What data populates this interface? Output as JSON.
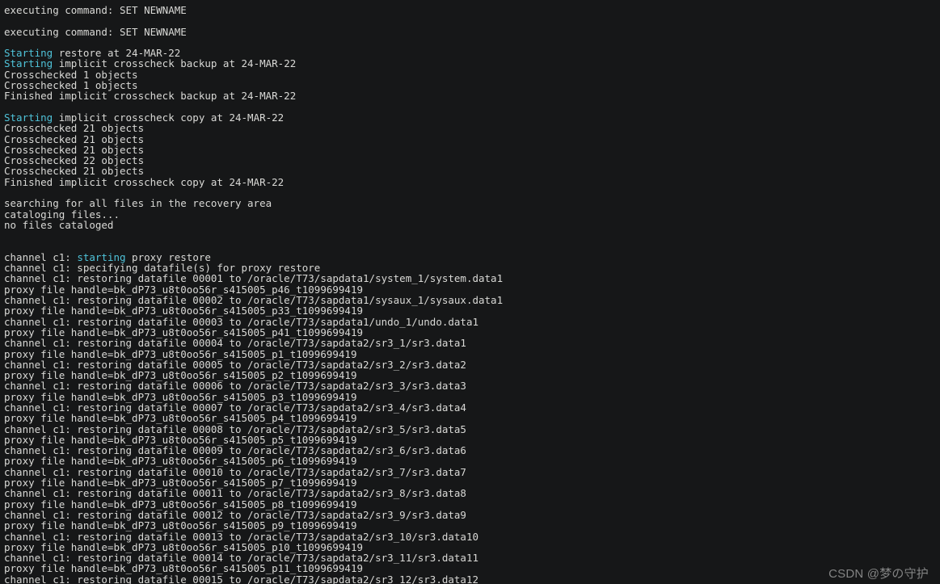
{
  "terminal": {
    "lines": [
      [
        {
          "t": "executing command: SET NEWNAME"
        }
      ],
      [],
      [
        {
          "t": "executing command: SET NEWNAME"
        }
      ],
      [],
      [
        {
          "t": "Starting",
          "hl": true
        },
        {
          "t": " restore at 24-MAR-22"
        }
      ],
      [
        {
          "t": "Starting",
          "hl": true
        },
        {
          "t": " implicit crosscheck backup at 24-MAR-22"
        }
      ],
      [
        {
          "t": "Crosschecked 1 objects"
        }
      ],
      [
        {
          "t": "Crosschecked 1 objects"
        }
      ],
      [
        {
          "t": "Finished implicit crosscheck backup at 24-MAR-22"
        }
      ],
      [],
      [
        {
          "t": "Starting",
          "hl": true
        },
        {
          "t": " implicit crosscheck copy at 24-MAR-22"
        }
      ],
      [
        {
          "t": "Crosschecked 21 objects"
        }
      ],
      [
        {
          "t": "Crosschecked 21 objects"
        }
      ],
      [
        {
          "t": "Crosschecked 21 objects"
        }
      ],
      [
        {
          "t": "Crosschecked 22 objects"
        }
      ],
      [
        {
          "t": "Crosschecked 21 objects"
        }
      ],
      [
        {
          "t": "Finished implicit crosscheck copy at 24-MAR-22"
        }
      ],
      [],
      [
        {
          "t": "searching for all files in the recovery area"
        }
      ],
      [
        {
          "t": "cataloging files..."
        }
      ],
      [
        {
          "t": "no files cataloged"
        }
      ],
      [],
      [],
      [
        {
          "t": "channel c1: "
        },
        {
          "t": "starting",
          "hl": true
        },
        {
          "t": " proxy restore"
        }
      ],
      [
        {
          "t": "channel c1: specifying datafile(s) for proxy restore"
        }
      ],
      [
        {
          "t": "channel c1: restoring datafile 00001 to /oracle/T73/sapdata1/system_1/system.data1"
        }
      ],
      [
        {
          "t": "proxy file handle=bk_dP73_u8t0oo56r_s415005_p46_t1099699419"
        }
      ],
      [
        {
          "t": "channel c1: restoring datafile 00002 to /oracle/T73/sapdata1/sysaux_1/sysaux.data1"
        }
      ],
      [
        {
          "t": "proxy file handle=bk_dP73_u8t0oo56r_s415005_p33_t1099699419"
        }
      ],
      [
        {
          "t": "channel c1: restoring datafile 00003 to /oracle/T73/sapdata1/undo_1/undo.data1"
        }
      ],
      [
        {
          "t": "proxy file handle=bk_dP73_u8t0oo56r_s415005_p41_t1099699419"
        }
      ],
      [
        {
          "t": "channel c1: restoring datafile 00004 to /oracle/T73/sapdata2/sr3_1/sr3.data1"
        }
      ],
      [
        {
          "t": "proxy file handle=bk_dP73_u8t0oo56r_s415005_p1_t1099699419"
        }
      ],
      [
        {
          "t": "channel c1: restoring datafile 00005 to /oracle/T73/sapdata2/sr3_2/sr3.data2"
        }
      ],
      [
        {
          "t": "proxy file handle=bk_dP73_u8t0oo56r_s415005_p2_t1099699419"
        }
      ],
      [
        {
          "t": "channel c1: restoring datafile 00006 to /oracle/T73/sapdata2/sr3_3/sr3.data3"
        }
      ],
      [
        {
          "t": "proxy file handle=bk_dP73_u8t0oo56r_s415005_p3_t1099699419"
        }
      ],
      [
        {
          "t": "channel c1: restoring datafile 00007 to /oracle/T73/sapdata2/sr3_4/sr3.data4"
        }
      ],
      [
        {
          "t": "proxy file handle=bk_dP73_u8t0oo56r_s415005_p4_t1099699419"
        }
      ],
      [
        {
          "t": "channel c1: restoring datafile 00008 to /oracle/T73/sapdata2/sr3_5/sr3.data5"
        }
      ],
      [
        {
          "t": "proxy file handle=bk_dP73_u8t0oo56r_s415005_p5_t1099699419"
        }
      ],
      [
        {
          "t": "channel c1: restoring datafile 00009 to /oracle/T73/sapdata2/sr3_6/sr3.data6"
        }
      ],
      [
        {
          "t": "proxy file handle=bk_dP73_u8t0oo56r_s415005_p6_t1099699419"
        }
      ],
      [
        {
          "t": "channel c1: restoring datafile 00010 to /oracle/T73/sapdata2/sr3_7/sr3.data7"
        }
      ],
      [
        {
          "t": "proxy file handle=bk_dP73_u8t0oo56r_s415005_p7_t1099699419"
        }
      ],
      [
        {
          "t": "channel c1: restoring datafile 00011 to /oracle/T73/sapdata2/sr3_8/sr3.data8"
        }
      ],
      [
        {
          "t": "proxy file handle=bk_dP73_u8t0oo56r_s415005_p8_t1099699419"
        }
      ],
      [
        {
          "t": "channel c1: restoring datafile 00012 to /oracle/T73/sapdata2/sr3_9/sr3.data9"
        }
      ],
      [
        {
          "t": "proxy file handle=bk_dP73_u8t0oo56r_s415005_p9_t1099699419"
        }
      ],
      [
        {
          "t": "channel c1: restoring datafile 00013 to /oracle/T73/sapdata2/sr3_10/sr3.data10"
        }
      ],
      [
        {
          "t": "proxy file handle=bk_dP73_u8t0oo56r_s415005_p10_t1099699419"
        }
      ],
      [
        {
          "t": "channel c1: restoring datafile 00014 to /oracle/T73/sapdata2/sr3_11/sr3.data11"
        }
      ],
      [
        {
          "t": "proxy file handle=bk_dP73_u8t0oo56r_s415005_p11_t1099699419"
        }
      ],
      [
        {
          "t": "channel c1: restoring datafile 00015 to /oracle/T73/sapdata2/sr3_12/sr3.data12"
        }
      ]
    ]
  },
  "watermark": "CSDN @梦の守护"
}
